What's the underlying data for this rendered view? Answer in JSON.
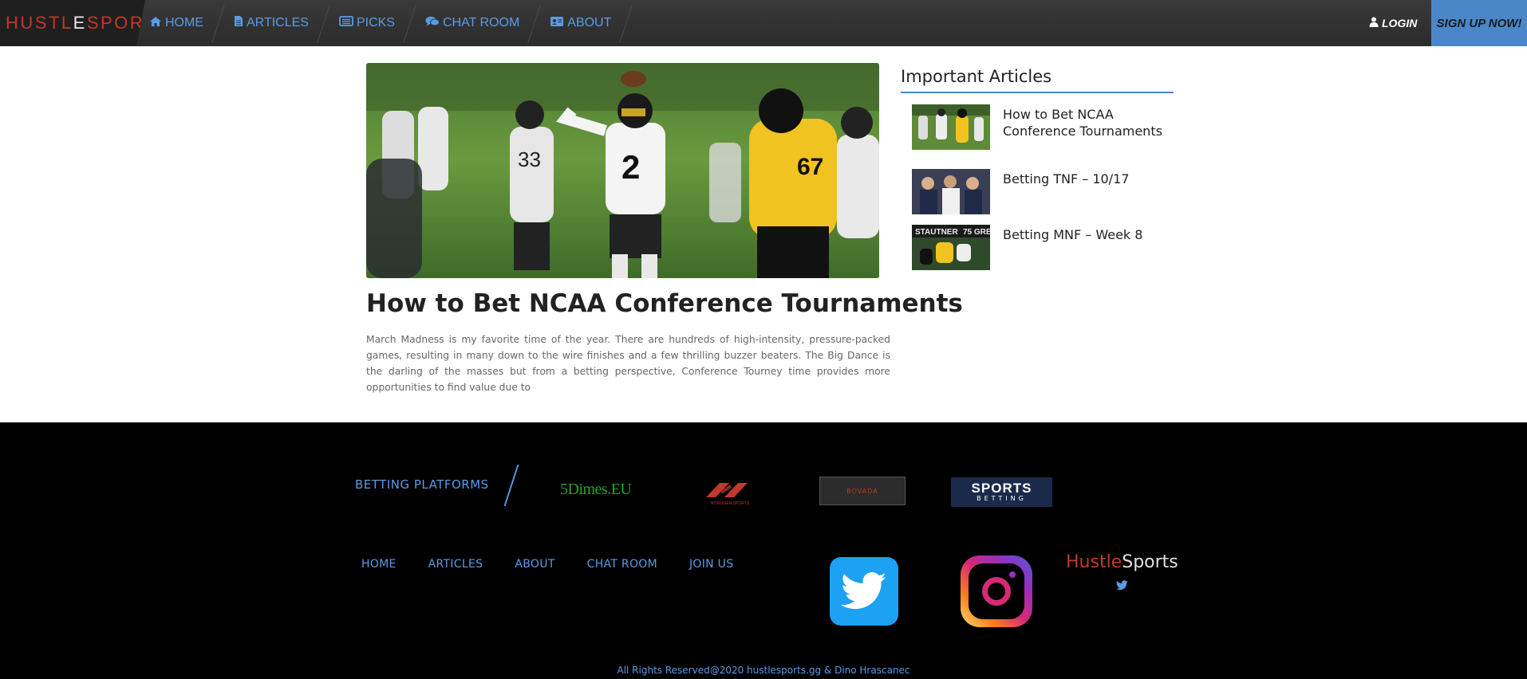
{
  "brand": {
    "part1": "HUSTL",
    "part2": "E",
    "part3": "SPORTS"
  },
  "nav": {
    "items": [
      {
        "label": "HOME",
        "icon": "home-icon"
      },
      {
        "label": "ARTICLES",
        "icon": "document-icon"
      },
      {
        "label": "PICKS",
        "icon": "list-icon"
      },
      {
        "label": "CHAT ROOM",
        "icon": "comments-icon"
      },
      {
        "label": "ABOUT",
        "icon": "id-card-icon"
      }
    ],
    "login": "LOGIN",
    "signup": "SIGN UP NOW!"
  },
  "article": {
    "title": "How to Bet NCAA Conference Tournaments",
    "excerpt": "March Madness is my favorite time of the year. There are hundreds of high-intensity, pressure-packed games, resulting in many down to the wire finishes and a few thrilling buzzer beaters. The Big Dance is the darling of the masses but from a betting perspective, Conference Tourney time provides more opportunities to find value due to"
  },
  "sidebar": {
    "title": "Important Articles",
    "items": [
      {
        "title": "How to Bet NCAA Conference Tournaments"
      },
      {
        "title": "Betting TNF – 10/17"
      },
      {
        "title": "Betting MNF – Week 8"
      }
    ]
  },
  "footer": {
    "platforms_label": "BETTING PLATFORMS",
    "platforms": [
      {
        "name": "5Dimes.EU"
      },
      {
        "name": "NITROGEN SPORTS"
      },
      {
        "name": "BOVADA"
      },
      {
        "name": "SPORTS",
        "sub": "BETTING"
      }
    ],
    "links": [
      "HOME",
      "ARTICLES",
      "ABOUT",
      "CHAT ROOM",
      "JOIN US"
    ],
    "brand_part1": "Hustle",
    "brand_part2": "Sports",
    "copyright": "All Rights Reserved@2020 hustlesports.gg & Dino Hrascanec"
  },
  "colors": {
    "accent": "#4a87c8",
    "link": "#5a9be6",
    "brand_red": "#c0392b",
    "nav_bg": "#333333",
    "footer_bg": "#000000"
  }
}
